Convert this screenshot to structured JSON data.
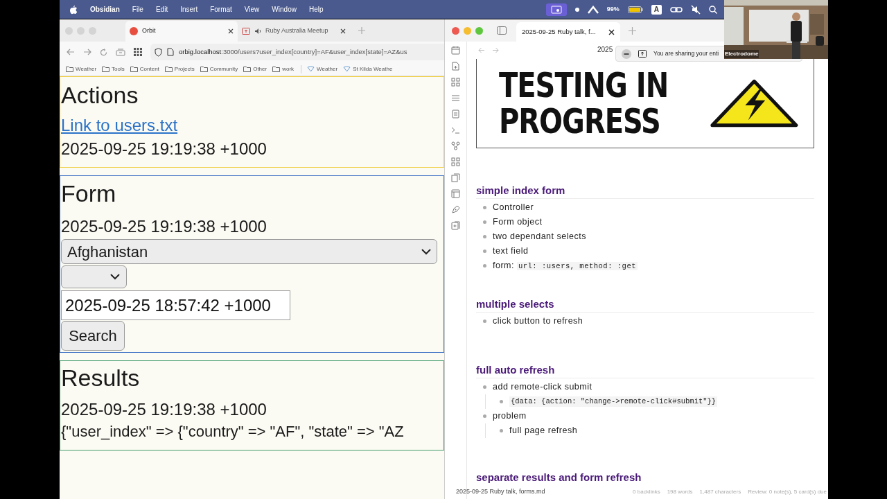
{
  "menubar": {
    "app": "Obsidian",
    "items": [
      "File",
      "Edit",
      "Insert",
      "Format",
      "View",
      "Window",
      "Help"
    ],
    "battery": "99%",
    "input_source": "A"
  },
  "browser": {
    "tabs": [
      {
        "title": "Orbit",
        "selected": true,
        "kind": "site"
      },
      {
        "title": "Ruby Australia Meetup",
        "selected": false,
        "kind": "audio"
      }
    ],
    "url": {
      "host": "orbig.localhost",
      "rest": ":3000/users?user_index[country]=AF&user_index[state]=AZ&us"
    },
    "bookmarks": [
      {
        "label": "Weather",
        "kind": "folder"
      },
      {
        "label": "Tools",
        "kind": "folder"
      },
      {
        "label": "Content",
        "kind": "folder"
      },
      {
        "label": "Projects",
        "kind": "folder"
      },
      {
        "label": "Community",
        "kind": "folder"
      },
      {
        "label": "Other",
        "kind": "folder"
      },
      {
        "label": "work",
        "kind": "folder"
      },
      {
        "label": "Weather",
        "kind": "link"
      },
      {
        "label": "St Kilda Weathe",
        "kind": "link"
      }
    ],
    "actions": {
      "heading": "Actions",
      "link": "Link to users.txt",
      "time": "2025-09-25 19:19:38 +1000"
    },
    "form": {
      "heading": "Form",
      "time": "2025-09-25 19:19:38 +1000",
      "country": "Afghanistan",
      "text_value": "2025-09-25 18:57:42 +1000",
      "button": "Search"
    },
    "results": {
      "heading": "Results",
      "time": "2025-09-25 19:19:38 +1000",
      "params": "{\"user_index\" => {\"country\" => \"AF\", \"state\" => \"AZ"
    }
  },
  "obsidian": {
    "tab_title": "2025-09-25 Ruby talk, f...",
    "nav_title": "2025",
    "image_lines": [
      "TESTING IN",
      "PROGRESS"
    ],
    "sections": [
      {
        "heading": "simple index form",
        "items": [
          {
            "text": "Controller"
          },
          {
            "text": "Form object"
          },
          {
            "text": "two dependant selects"
          },
          {
            "text": "text field"
          },
          {
            "text": "form:",
            "code": "url: :users, method: :get"
          }
        ]
      },
      {
        "heading": "multiple selects",
        "items": [
          {
            "text": "click button to refresh"
          }
        ]
      },
      {
        "heading": "full auto refresh",
        "items": [
          {
            "text": "add remote-click submit",
            "children": [
              {
                "code": "{data: {action: \"change->remote-click#submit\"}}"
              }
            ]
          },
          {
            "text": "problem",
            "children": [
              {
                "text": "full page refresh"
              }
            ]
          }
        ]
      },
      {
        "heading": "separate results and form refresh"
      }
    ],
    "status": {
      "file": "2025-09-25 Ruby talk, forms.md",
      "backlinks": "0 backlinks",
      "words": "198 words",
      "characters": "1,487 characters",
      "review": "Review: 0 note(s), 5 card(s) due"
    }
  },
  "share_banner": "You are sharing your enti",
  "camera": {
    "label": "Electrodome"
  }
}
